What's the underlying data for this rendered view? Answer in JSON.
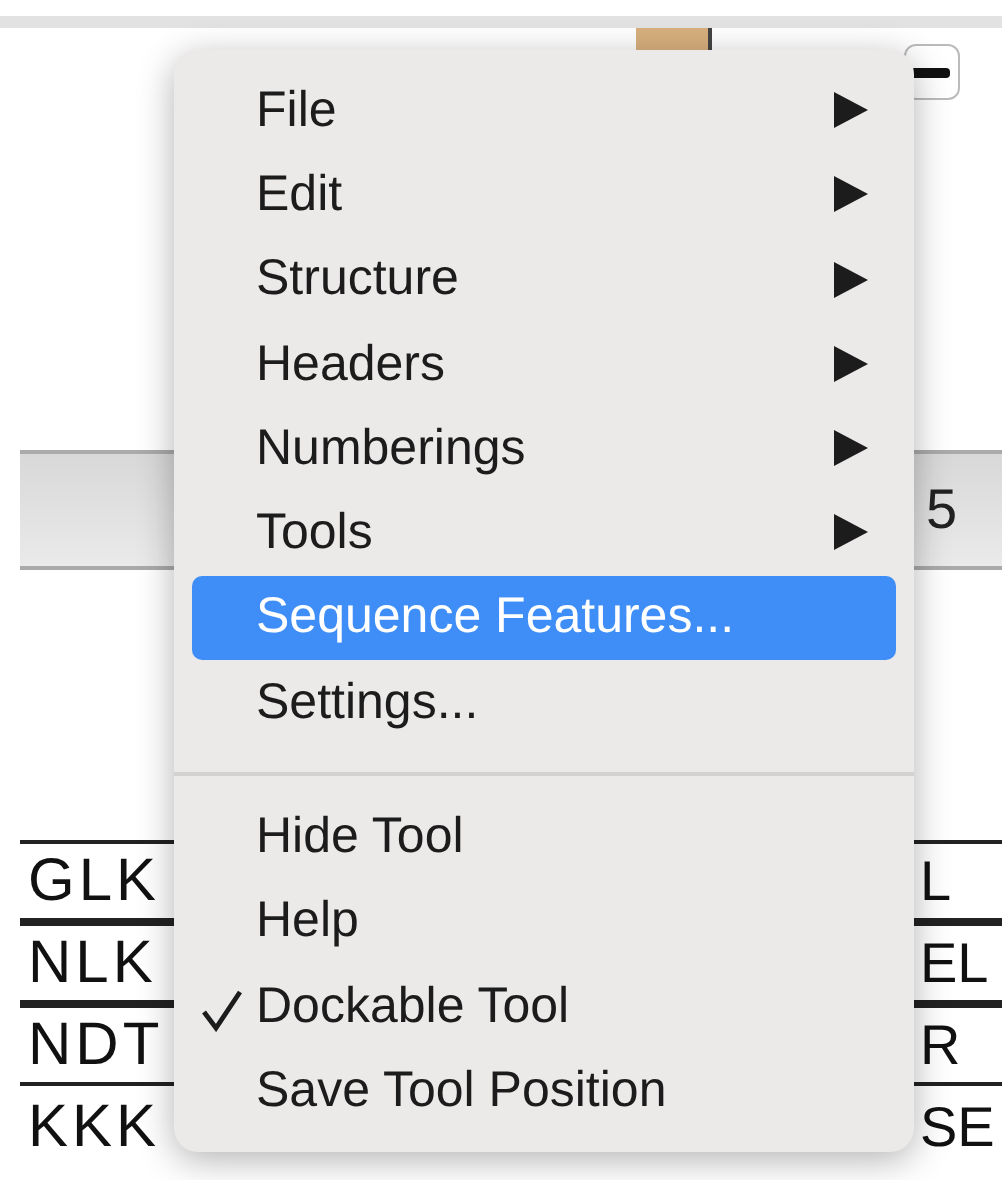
{
  "background": {
    "position_label": "5",
    "sequence_rows": [
      {
        "left": "GLK",
        "right": "L",
        "ruled": true
      },
      {
        "left": "NLK",
        "right": "EL",
        "ruled": true
      },
      {
        "left": "NDT",
        "right": "R",
        "ruled": true
      },
      {
        "left": "KKK",
        "right": "SE",
        "ruled": false
      }
    ]
  },
  "menu": {
    "groups": [
      [
        {
          "label": "File",
          "submenu": true,
          "selected": false,
          "checked": false
        },
        {
          "label": "Edit",
          "submenu": true,
          "selected": false,
          "checked": false
        },
        {
          "label": "Structure",
          "submenu": true,
          "selected": false,
          "checked": false
        },
        {
          "label": "Headers",
          "submenu": true,
          "selected": false,
          "checked": false
        },
        {
          "label": "Numberings",
          "submenu": true,
          "selected": false,
          "checked": false
        },
        {
          "label": "Tools",
          "submenu": true,
          "selected": false,
          "checked": false
        },
        {
          "label": "Sequence Features...",
          "submenu": false,
          "selected": true,
          "checked": false
        },
        {
          "label": "Settings...",
          "submenu": false,
          "selected": false,
          "checked": false
        }
      ],
      [
        {
          "label": "Hide Tool",
          "submenu": false,
          "selected": false,
          "checked": false
        },
        {
          "label": "Help",
          "submenu": false,
          "selected": false,
          "checked": false
        },
        {
          "label": "Dockable Tool",
          "submenu": false,
          "selected": false,
          "checked": true
        },
        {
          "label": "Save Tool Position",
          "submenu": false,
          "selected": false,
          "checked": false
        }
      ]
    ]
  }
}
